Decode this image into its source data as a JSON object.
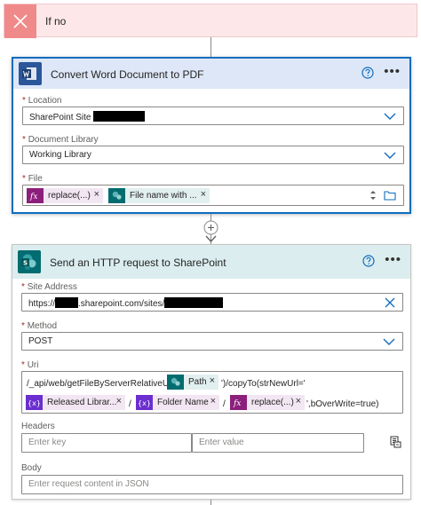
{
  "condition": {
    "label": "If no"
  },
  "word_card": {
    "title": "Convert Word Document to PDF",
    "location": {
      "label": "Location",
      "value": "SharePoint Site"
    },
    "library": {
      "label": "Document Library",
      "value": "Working Library"
    },
    "file": {
      "label": "File",
      "tokens": [
        {
          "label": "replace(...)",
          "type": "expression"
        },
        {
          "label": "File name with ...",
          "type": "dynamic"
        }
      ]
    }
  },
  "http_card": {
    "title": "Send an HTTP request to SharePoint",
    "site_address": {
      "label": "Site Address",
      "prefix": "https://",
      "middle": ".sharepoint.com/sites/"
    },
    "method": {
      "label": "Method",
      "value": "POST"
    },
    "uri": {
      "label": "Uri",
      "line1_text": "/_api/web/getFileByServerRelativeUrl('",
      "line1_token": "Path",
      "line1_suffix": "')/copyTo(strNewUrl='",
      "line2_tokens": [
        "Released Librar...",
        "Folder Name",
        "replace(...)"
      ],
      "separator": "/",
      "line2_suffix": "',bOverWrite=true)"
    },
    "headers": {
      "label": "Headers",
      "key_placeholder": "Enter key",
      "value_placeholder": "Enter value"
    },
    "body": {
      "label": "Body",
      "placeholder": "Enter request content in JSON"
    }
  },
  "required_marker": "*",
  "colors": {
    "accent": "#0f6cbd",
    "word": "#2b579a",
    "sharepoint": "#036c70",
    "expression": "#8c1f7c",
    "variable": "#6b2fcf"
  }
}
